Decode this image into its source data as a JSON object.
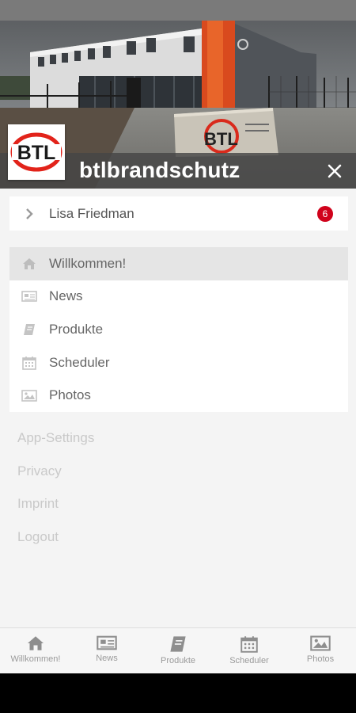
{
  "header": {
    "app_title": "btlbrandschutz",
    "logo_text": "BTL",
    "sign_text": "BTL",
    "close_icon": "close-icon"
  },
  "user": {
    "name": "Lisa Friedman",
    "badge_count": "6"
  },
  "menu": {
    "items": [
      {
        "label": "Willkommen!",
        "icon": "home-icon",
        "active": true
      },
      {
        "label": "News",
        "icon": "newspaper-icon",
        "active": false
      },
      {
        "label": "Produkte",
        "icon": "book-icon",
        "active": false
      },
      {
        "label": "Scheduler",
        "icon": "calendar-icon",
        "active": false
      },
      {
        "label": "Photos",
        "icon": "image-icon",
        "active": false
      }
    ]
  },
  "links": [
    "App-Settings",
    "Privacy",
    "Imprint",
    "Logout"
  ],
  "tabs": [
    {
      "label": "Willkommen!",
      "icon": "home-icon"
    },
    {
      "label": "News",
      "icon": "newspaper-icon"
    },
    {
      "label": "Produkte",
      "icon": "book-icon"
    },
    {
      "label": "Scheduler",
      "icon": "calendar-icon"
    },
    {
      "label": "Photos",
      "icon": "image-icon"
    }
  ],
  "colors": {
    "badge": "#d0021b",
    "brand_red": "#e2231a"
  }
}
